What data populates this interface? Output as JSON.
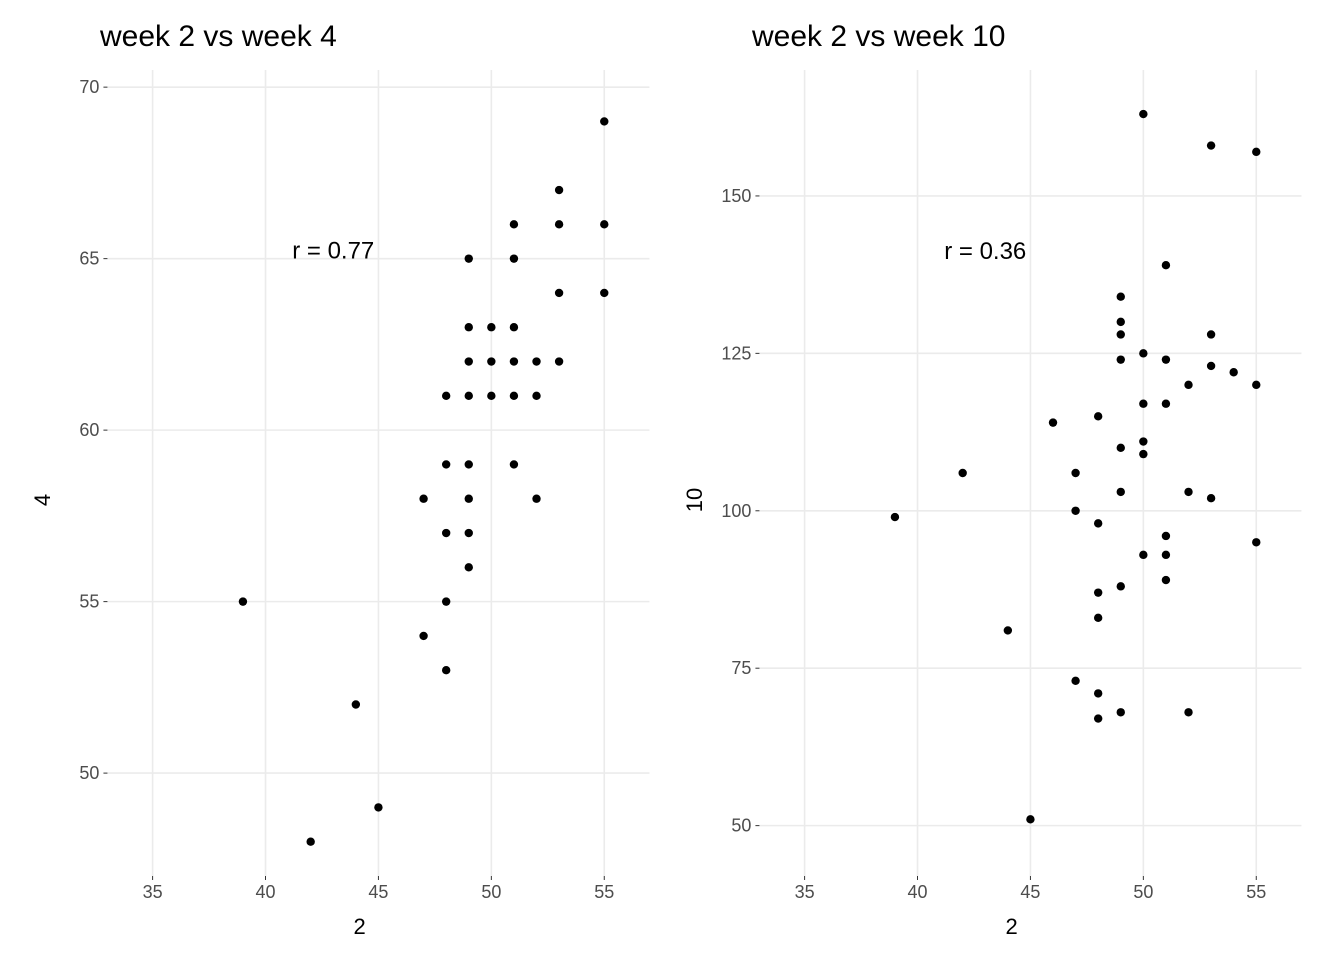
{
  "chart_data": [
    {
      "type": "scatter",
      "title": "week 2 vs week 4",
      "xlabel": "2",
      "ylabel": "4",
      "xlim": [
        33,
        57
      ],
      "ylim": [
        47,
        70.5
      ],
      "xticks": [
        35,
        40,
        45,
        50,
        55
      ],
      "yticks": [
        50,
        55,
        60,
        65,
        70
      ],
      "annotation": "r = 0.77",
      "annotation_pos": {
        "x": 43,
        "y": 65
      },
      "points": [
        {
          "x": 39,
          "y": 55
        },
        {
          "x": 42,
          "y": 48
        },
        {
          "x": 44,
          "y": 52
        },
        {
          "x": 45,
          "y": 49
        },
        {
          "x": 47,
          "y": 54
        },
        {
          "x": 47,
          "y": 58
        },
        {
          "x": 48,
          "y": 53
        },
        {
          "x": 48,
          "y": 55
        },
        {
          "x": 48,
          "y": 57
        },
        {
          "x": 48,
          "y": 59
        },
        {
          "x": 48,
          "y": 61
        },
        {
          "x": 49,
          "y": 56
        },
        {
          "x": 49,
          "y": 57
        },
        {
          "x": 49,
          "y": 58
        },
        {
          "x": 49,
          "y": 59
        },
        {
          "x": 49,
          "y": 61
        },
        {
          "x": 49,
          "y": 62
        },
        {
          "x": 49,
          "y": 63
        },
        {
          "x": 49,
          "y": 65
        },
        {
          "x": 50,
          "y": 61
        },
        {
          "x": 50,
          "y": 62
        },
        {
          "x": 50,
          "y": 63
        },
        {
          "x": 51,
          "y": 59
        },
        {
          "x": 51,
          "y": 61
        },
        {
          "x": 51,
          "y": 62
        },
        {
          "x": 51,
          "y": 63
        },
        {
          "x": 51,
          "y": 65
        },
        {
          "x": 51,
          "y": 66
        },
        {
          "x": 52,
          "y": 58
        },
        {
          "x": 52,
          "y": 61
        },
        {
          "x": 52,
          "y": 62
        },
        {
          "x": 53,
          "y": 62
        },
        {
          "x": 53,
          "y": 64
        },
        {
          "x": 53,
          "y": 66
        },
        {
          "x": 53,
          "y": 67
        },
        {
          "x": 55,
          "y": 64
        },
        {
          "x": 55,
          "y": 66
        },
        {
          "x": 55,
          "y": 69
        }
      ]
    },
    {
      "type": "scatter",
      "title": "week 2 vs week 10",
      "xlabel": "2",
      "ylabel": "10",
      "xlim": [
        33,
        57
      ],
      "ylim": [
        42,
        170
      ],
      "xticks": [
        35,
        40,
        45,
        50,
        55
      ],
      "yticks": [
        50,
        75,
        100,
        125,
        150
      ],
      "annotation": "r = 0.36",
      "annotation_pos": {
        "x": 43,
        "y": 140
      },
      "points": [
        {
          "x": 39,
          "y": 99
        },
        {
          "x": 42,
          "y": 106
        },
        {
          "x": 44,
          "y": 81
        },
        {
          "x": 45,
          "y": 51
        },
        {
          "x": 46,
          "y": 114
        },
        {
          "x": 47,
          "y": 73
        },
        {
          "x": 47,
          "y": 100
        },
        {
          "x": 47,
          "y": 106
        },
        {
          "x": 48,
          "y": 67
        },
        {
          "x": 48,
          "y": 71
        },
        {
          "x": 48,
          "y": 83
        },
        {
          "x": 48,
          "y": 87
        },
        {
          "x": 48,
          "y": 98
        },
        {
          "x": 48,
          "y": 115
        },
        {
          "x": 49,
          "y": 68
        },
        {
          "x": 49,
          "y": 88
        },
        {
          "x": 49,
          "y": 103
        },
        {
          "x": 49,
          "y": 110
        },
        {
          "x": 49,
          "y": 124
        },
        {
          "x": 49,
          "y": 128
        },
        {
          "x": 49,
          "y": 130
        },
        {
          "x": 49,
          "y": 134
        },
        {
          "x": 50,
          "y": 93
        },
        {
          "x": 50,
          "y": 109
        },
        {
          "x": 50,
          "y": 111
        },
        {
          "x": 50,
          "y": 117
        },
        {
          "x": 50,
          "y": 125
        },
        {
          "x": 50,
          "y": 163
        },
        {
          "x": 51,
          "y": 89
        },
        {
          "x": 51,
          "y": 93
        },
        {
          "x": 51,
          "y": 96
        },
        {
          "x": 51,
          "y": 117
        },
        {
          "x": 51,
          "y": 124
        },
        {
          "x": 51,
          "y": 139
        },
        {
          "x": 52,
          "y": 68
        },
        {
          "x": 52,
          "y": 103
        },
        {
          "x": 52,
          "y": 120
        },
        {
          "x": 53,
          "y": 102
        },
        {
          "x": 53,
          "y": 123
        },
        {
          "x": 53,
          "y": 128
        },
        {
          "x": 53,
          "y": 158
        },
        {
          "x": 54,
          "y": 122
        },
        {
          "x": 55,
          "y": 95
        },
        {
          "x": 55,
          "y": 120
        },
        {
          "x": 55,
          "y": 157
        }
      ]
    }
  ]
}
